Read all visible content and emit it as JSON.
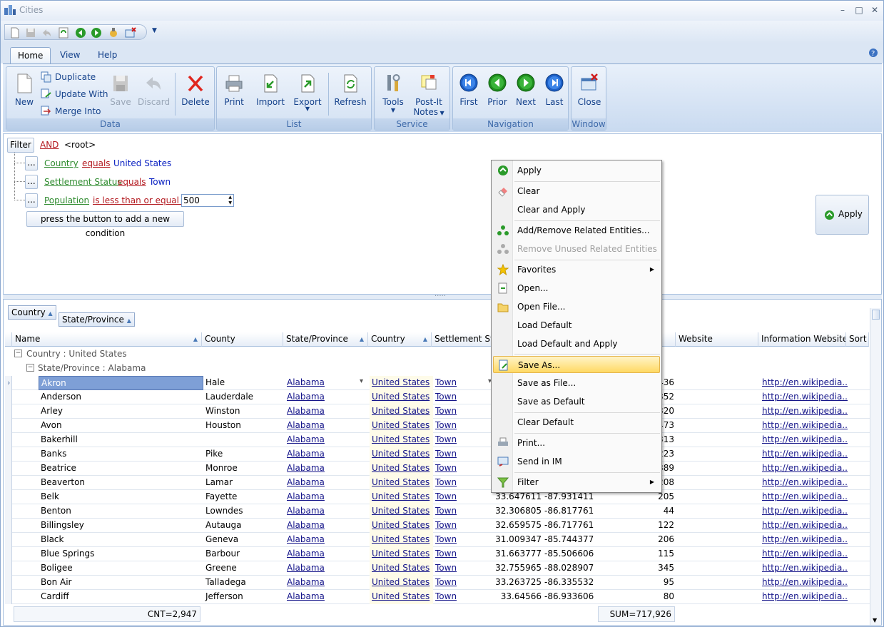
{
  "window": {
    "title": "Cities",
    "minimize": "–",
    "maximize": "□",
    "close": "✕"
  },
  "tabs": [
    {
      "label": "Home"
    },
    {
      "label": "View"
    },
    {
      "label": "Help"
    }
  ],
  "ribbon": {
    "data": {
      "label": "Data",
      "new": "New",
      "duplicate": "Duplicate",
      "update_with": "Update With",
      "merge_into": "Merge Into",
      "save": "Save",
      "discard": "Discard",
      "delete": "Delete"
    },
    "list": {
      "label": "List",
      "print": "Print",
      "import": "Import",
      "export": "Export",
      "refresh": "Refresh"
    },
    "service": {
      "label": "Service",
      "tools": "Tools",
      "postit": "Post-It",
      "notes": "Notes"
    },
    "navigation": {
      "label": "Navigation",
      "first": "First",
      "prior": "Prior",
      "next": "Next",
      "last": "Last"
    },
    "window": {
      "label": "Window",
      "close": "Close"
    }
  },
  "filter": {
    "filter_button": "Filter",
    "operator": "AND",
    "root": "<root>",
    "conditions": [
      {
        "field": "Country",
        "op": "equals",
        "value": "United States"
      },
      {
        "field": "Settlement Status",
        "op": "equals",
        "value": "Town"
      },
      {
        "field": "Population",
        "op": "is less than or equal to",
        "value": "500"
      }
    ],
    "ellipsis": "...",
    "add_hint": "press the button to add a new condition",
    "apply": "Apply"
  },
  "grid": {
    "group_tags": [
      "Country",
      "State/Province"
    ],
    "columns": [
      "Name",
      "County",
      "State/Province",
      "Country",
      "Settlement Sta...",
      "Website",
      "Information Website",
      "Sort"
    ],
    "group_country": "Country : United States",
    "group_state": "State/Province : Alabama",
    "rows": [
      {
        "name": "Akron",
        "county": "Hale",
        "state": "Alabama",
        "country": "United States",
        "status": "Town",
        "lat": "",
        "lon": "",
        "pop": "436",
        "info": "http://en.wikipedia...."
      },
      {
        "name": "Anderson",
        "county": "Lauderdale",
        "state": "Alabama",
        "country": "United States",
        "status": "Town",
        "lat": "",
        "lon": "",
        "pop": "352",
        "info": "http://en.wikipedia...."
      },
      {
        "name": "Arley",
        "county": "Winston",
        "state": "Alabama",
        "country": "United States",
        "status": "Town",
        "lat": "",
        "lon": "",
        "pop": "320",
        "info": "http://en.wikipedia...."
      },
      {
        "name": "Avon",
        "county": "Houston",
        "state": "Alabama",
        "country": "United States",
        "status": "Town",
        "lat": "",
        "lon": "",
        "pop": "473",
        "info": "http://en.wikipedia...."
      },
      {
        "name": "Bakerhill",
        "county": "",
        "state": "Alabama",
        "country": "United States",
        "status": "Town",
        "lat": "",
        "lon": "",
        "pop": "313",
        "info": "http://en.wikipedia...."
      },
      {
        "name": "Banks",
        "county": "Pike",
        "state": "Alabama",
        "country": "United States",
        "status": "Town",
        "lat": "",
        "lon": "",
        "pop": "223",
        "info": "http://en.wikipedia...."
      },
      {
        "name": "Beatrice",
        "county": "Monroe",
        "state": "Alabama",
        "country": "United States",
        "status": "Town",
        "lat": "",
        "lon": "",
        "pop": "389",
        "info": "http://en.wikipedia...."
      },
      {
        "name": "Beaverton",
        "county": "Lamar",
        "state": "Alabama",
        "country": "United States",
        "status": "Town",
        "lat": "",
        "lon": "",
        "pop": "208",
        "info": "http://en.wikipedia...."
      },
      {
        "name": "Belk",
        "county": "Fayette",
        "state": "Alabama",
        "country": "United States",
        "status": "Town",
        "lat": "33.647611",
        "lon": "-87.931411",
        "pop": "205",
        "info": "http://en.wikipedia...."
      },
      {
        "name": "Benton",
        "county": "Lowndes",
        "state": "Alabama",
        "country": "United States",
        "status": "Town",
        "lat": "32.306805",
        "lon": "-86.817761",
        "pop": "44",
        "info": "http://en.wikipedia...."
      },
      {
        "name": "Billingsley",
        "county": "Autauga",
        "state": "Alabama",
        "country": "United States",
        "status": "Town",
        "lat": "32.659575",
        "lon": "-86.717761",
        "pop": "122",
        "info": "http://en.wikipedia...."
      },
      {
        "name": "Black",
        "county": "Geneva",
        "state": "Alabama",
        "country": "United States",
        "status": "Town",
        "lat": "31.009347",
        "lon": "-85.744377",
        "pop": "206",
        "info": "http://en.wikipedia...."
      },
      {
        "name": "Blue Springs",
        "county": "Barbour",
        "state": "Alabama",
        "country": "United States",
        "status": "Town",
        "lat": "31.663777",
        "lon": "-85.506606",
        "pop": "115",
        "info": "http://en.wikipedia...."
      },
      {
        "name": "Boligee",
        "county": "Greene",
        "state": "Alabama",
        "country": "United States",
        "status": "Town",
        "lat": "32.755965",
        "lon": "-88.028907",
        "pop": "345",
        "info": "http://en.wikipedia...."
      },
      {
        "name": "Bon Air",
        "county": "Talladega",
        "state": "Alabama",
        "country": "United States",
        "status": "Town",
        "lat": "33.263725",
        "lon": "-86.335532",
        "pop": "95",
        "info": "http://en.wikipedia...."
      },
      {
        "name": "Cardiff",
        "county": "Jefferson",
        "state": "Alabama",
        "country": "United States",
        "status": "Town",
        "lat": "33.64566",
        "lon": "-86.933606",
        "pop": "80",
        "info": "http://en.wikipedia...."
      }
    ],
    "footer_count": "CNT=2,947",
    "footer_sum": "SUM=717,926"
  },
  "context_menu": {
    "items": [
      "Apply",
      "Clear",
      "Clear and Apply",
      "Add/Remove Related Entities...",
      "Remove Unused Related Entities",
      "Favorites",
      "Open...",
      "Open File...",
      "Load Default",
      "Load Default and Apply",
      "Save As...",
      "Save as File...",
      "Save as Default",
      "Clear Default",
      "Print...",
      "Send in IM",
      "Filter"
    ]
  }
}
